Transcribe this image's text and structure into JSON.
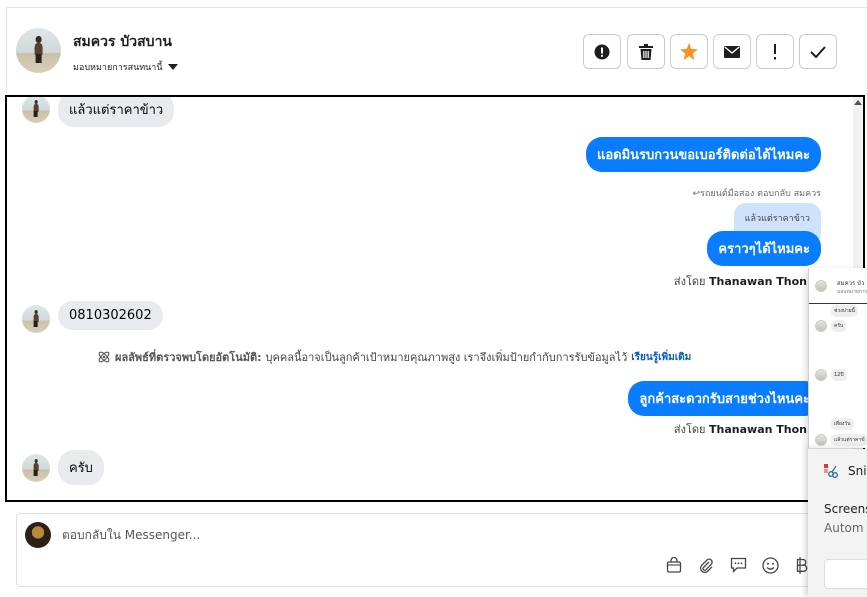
{
  "header": {
    "contact_name": "สมควร บัวสบาน",
    "assign_label": "มอบหมายการสนทนานี้",
    "buttons": [
      {
        "name": "alert-circle",
        "icon": "exclamation-circle-icon"
      },
      {
        "name": "trash",
        "icon": "trash-icon"
      },
      {
        "name": "star",
        "icon": "star-icon"
      },
      {
        "name": "mail",
        "icon": "envelope-icon"
      },
      {
        "name": "important",
        "icon": "exclamation-icon"
      },
      {
        "name": "done",
        "icon": "check-icon"
      }
    ],
    "star_color": "#f7931e"
  },
  "messages": {
    "m1_in": "แล้วแต่ราคาข้าว",
    "m2_out": "แอดมินรบกวนขอเบอร์ติดต่อได้ไหมคะ",
    "m3_reply_note": "↩รถยนต์มือสอง ตอบกลับ สมควร",
    "m3_quote": "แล้วแต่ราคาข้าว",
    "m3_out": "คราวๆได้ไหมคะ",
    "m3_sent_prefix": "ส่งโดย",
    "m3_sent_name": "Thanawan Thon",
    "m4_in": "0810302602",
    "detect_bold": "ผลลัพธ์ที่ตรวจพบโดยอัตโนมัติ:",
    "detect_text": "บุคคลนี้อาจเป็นลูกค้าเป้าหมายคุณภาพสูง เราจึงเพิ่มป้ายกำกับการรับข้อมูลไว้",
    "detect_link": "เรียนรู้เพิ่มเติม",
    "m5_out": "ลูกค้าสะดวกรับสายช่วงไหนคะ",
    "m5_sent_prefix": "ส่งโดย",
    "m5_sent_name": "Thanawan Thon",
    "m6_in": "ครับ"
  },
  "accent_color": "#0a7cff",
  "composer": {
    "placeholder": "ตอบกลับใน Messenger...",
    "icons": [
      "bag-icon",
      "paperclip-icon",
      "chat-bubble-icon",
      "smiley-icon",
      "baht-icon"
    ]
  },
  "mini_panel": {
    "row1": "สมควร บัว",
    "row1_sub": "มอบหมายการสน",
    "b1": "ช่วงบ่ายนี้",
    "b2": "ครับ",
    "b3": "12ปี",
    "b4": "เที่ยงวัน",
    "b5": "แล้วแต่ราคาข้"
  },
  "snip": {
    "title": "Snip",
    "line1": "Screens",
    "line2": "Autom"
  }
}
